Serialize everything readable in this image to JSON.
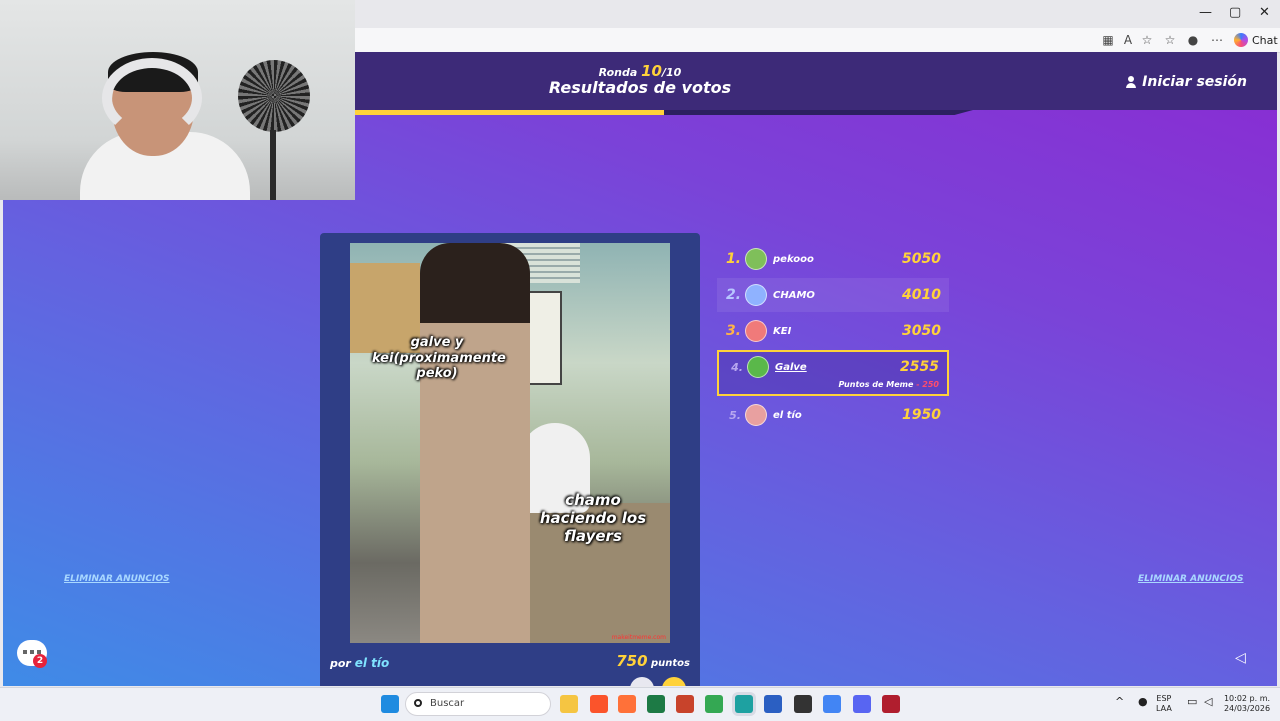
{
  "browser": {
    "window_controls": [
      "—",
      "▢",
      "✕"
    ],
    "toolbar_icons": [
      "apps-icon",
      "translate-icon",
      "favorite-star-icon",
      "collections-icon",
      "profile-icon",
      "more-icon"
    ],
    "chat_label": "Chat"
  },
  "game": {
    "header": {
      "round_prefix": "Ronda",
      "round_current": "10",
      "round_total": "/10",
      "title": "Resultados de votos",
      "login_label": "Iniciar sesión"
    },
    "round_progress": 0.5,
    "meme_card": {
      "caption_top": "galve y kei(proximamente peko)",
      "caption_bottom": "chamo haciendo los flayers",
      "watermark": "makeitmeme.com",
      "by_prefix": "por",
      "author": "el tío",
      "points_value": "750",
      "points_label": "puntos"
    },
    "leaderboard": [
      {
        "rank": "1.",
        "name": "pekooo",
        "score": "5050",
        "avatar_color": "#7fbf5a"
      },
      {
        "rank": "2.",
        "name": "CHAMO",
        "score": "4010",
        "avatar_color": "#8fb2ff"
      },
      {
        "rank": "3.",
        "name": "KEI",
        "score": "3050",
        "avatar_color": "#f07a7a"
      },
      {
        "rank": "4.",
        "name": "Galve",
        "score": "2555",
        "avatar_color": "#5ab84a",
        "sub_label": "Puntos de Meme",
        "sub_delta": "- 250"
      },
      {
        "rank": "5.",
        "name": "el tío",
        "score": "1950",
        "avatar_color": "#e8a0a0"
      }
    ],
    "remove_ads_left": "ELIMINAR ANUNCIOS",
    "remove_ads_right": "ELIMINAR ANUNCIOS",
    "chat_badge": "2"
  },
  "taskbar": {
    "search_placeholder": "Buscar",
    "lang_top": "ESP",
    "lang_bottom": "LAA",
    "time": "10:02 p. m.",
    "date": "24/03/2026",
    "accent": "#ffd23a"
  }
}
